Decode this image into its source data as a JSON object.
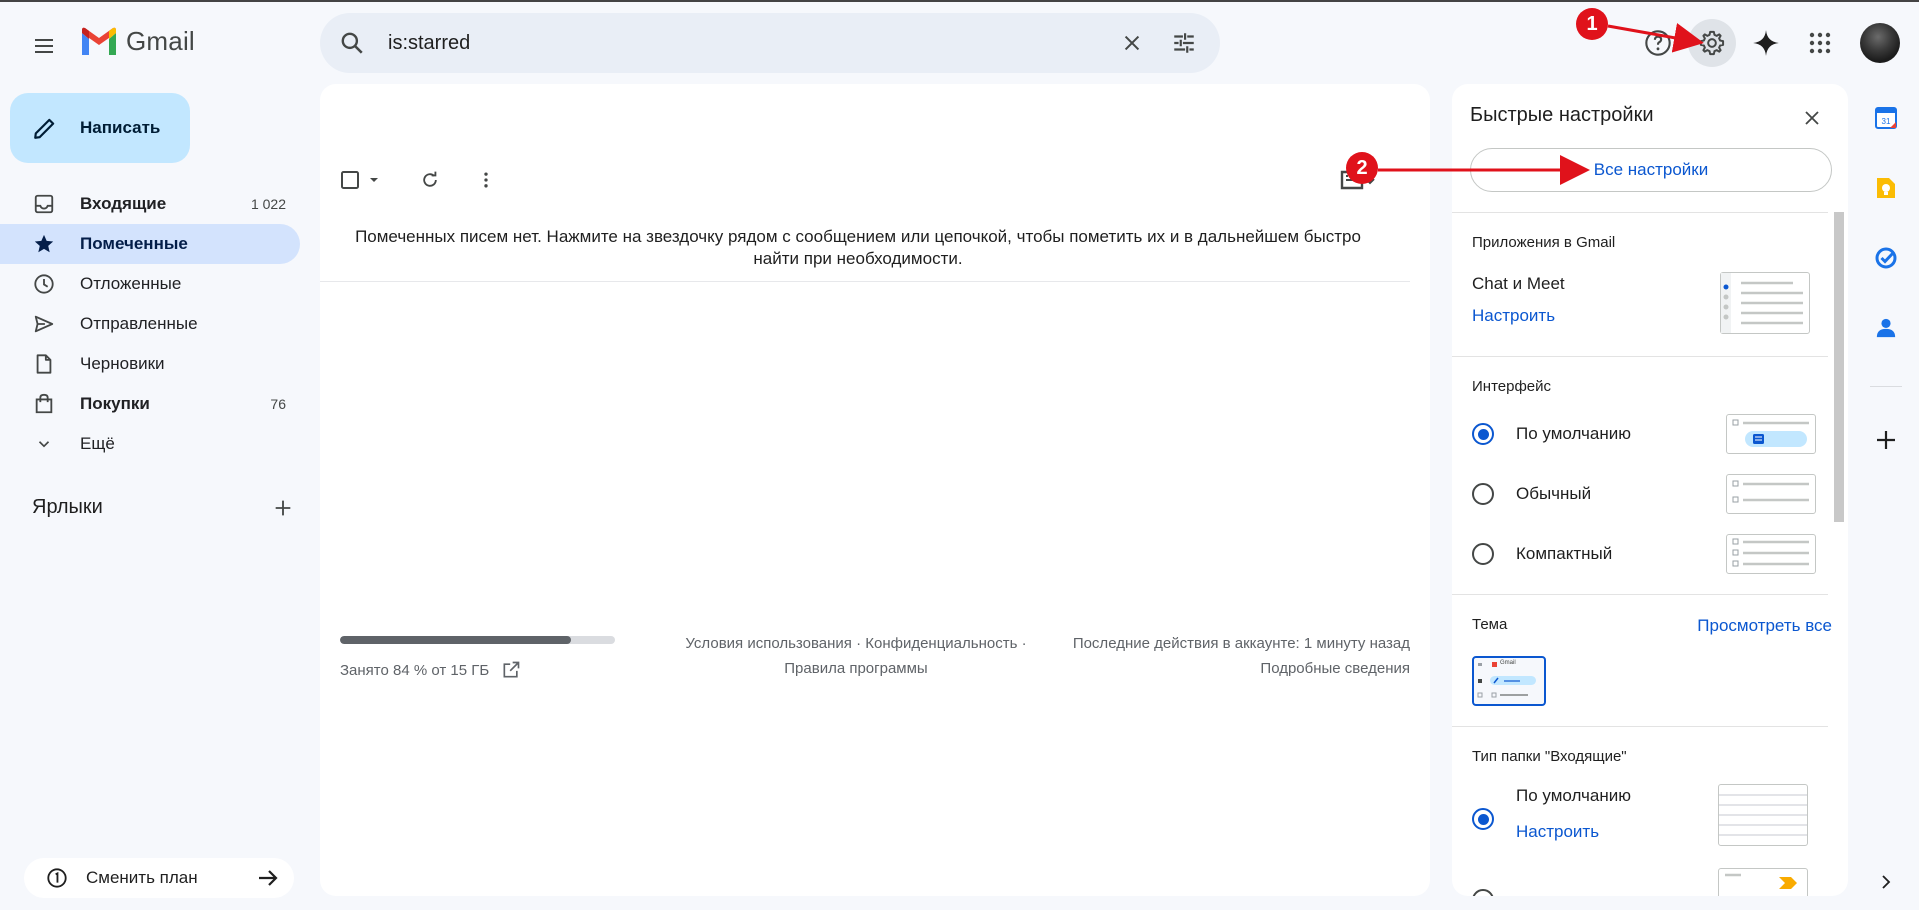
{
  "app": {
    "logo_text": "Gmail"
  },
  "search": {
    "value": "is:starred"
  },
  "compose": {
    "label": "Написать"
  },
  "nav": {
    "items": [
      {
        "label": "Входящие",
        "count": "1 022"
      },
      {
        "label": "Помеченные",
        "count": ""
      },
      {
        "label": "Отложенные",
        "count": ""
      },
      {
        "label": "Отправленные",
        "count": ""
      },
      {
        "label": "Черновики",
        "count": ""
      },
      {
        "label": "Покупки",
        "count": "76"
      },
      {
        "label": "Ещё",
        "count": ""
      }
    ]
  },
  "labels": {
    "title": "Ярлыки"
  },
  "plan": {
    "label": "Сменить план"
  },
  "main": {
    "empty_message": "Помеченных писем нет. Нажмите на звездочку рядом с сообщением или цепочкой, чтобы пометить их и в дальнейшем быстро найти при необходимости.",
    "storage": {
      "label": "Занято 84 % от 15 ГБ",
      "used_fraction": 0.84
    },
    "footer": {
      "terms": "Условия использования",
      "privacy": "Конфиденциальность",
      "sep": "·",
      "program": "Правила программы",
      "activity": "Последние действия в аккаунте: 1 минуту назад",
      "details": "Подробные сведения"
    }
  },
  "quick_settings": {
    "title": "Быстрые настройки",
    "all_settings": "Все настройки",
    "apps_section": "Приложения в Gmail",
    "chat_meet": "Chat и Meet",
    "configure": "Настроить",
    "density_section": "Интерфейс",
    "density": [
      {
        "label": "По умолчанию",
        "selected": true
      },
      {
        "label": "Обычный",
        "selected": false
      },
      {
        "label": "Компактный",
        "selected": false
      }
    ],
    "theme_section": "Тема",
    "theme_view_all": "Просмотреть все",
    "theme_thumb_text": "Gmail",
    "inbox_type_section": "Тип папки \"Входящие\"",
    "inbox_default": "По умолчанию",
    "inbox_configure": "Настроить"
  },
  "annotations": {
    "badge1": "1",
    "badge2": "2"
  },
  "colors": {
    "accent": "#0b57d0",
    "compose_bg": "#c2e7ff",
    "active_nav_bg": "#d3e3fd",
    "annotation_red": "#e0121b"
  },
  "icons": [
    "menu-icon",
    "gmail-logo-icon",
    "search-icon",
    "clear-icon",
    "tune-icon",
    "help-icon",
    "gear-icon",
    "gemini-icon",
    "apps-icon",
    "pencil-icon",
    "inbox-icon",
    "star-icon",
    "clock-icon",
    "send-icon",
    "draft-icon",
    "shopping-icon",
    "chevron-down-icon",
    "plus-icon",
    "info-icon",
    "arrow-right-icon",
    "checkbox-icon",
    "refresh-icon",
    "more-vert-icon",
    "external-link-icon",
    "close-icon",
    "calendar-icon",
    "keep-icon",
    "tasks-icon",
    "contacts-icon",
    "chevron-right-icon"
  ]
}
